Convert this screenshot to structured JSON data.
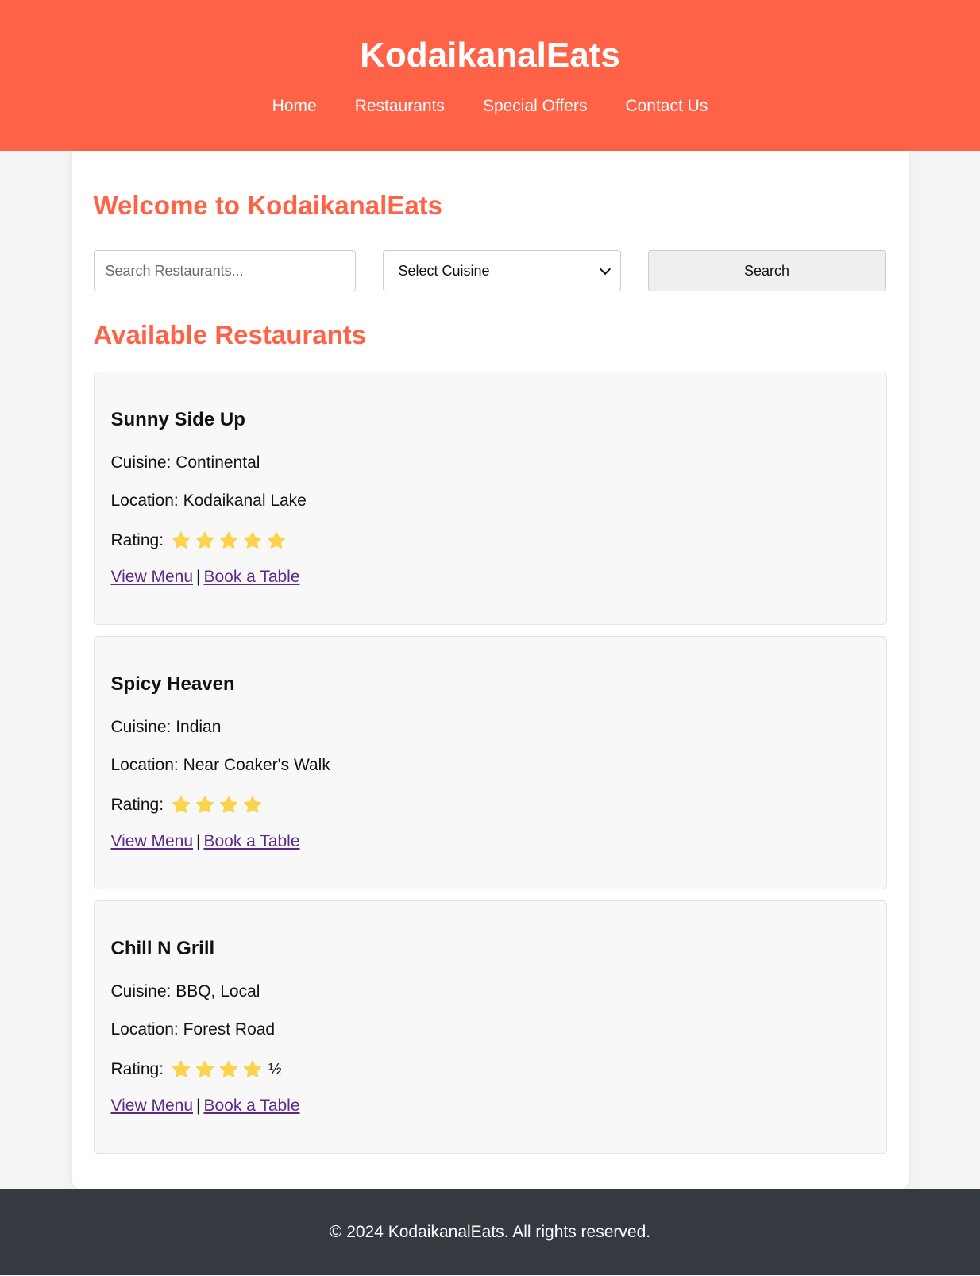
{
  "header": {
    "title": "KodaikanalEats",
    "nav": [
      "Home",
      "Restaurants",
      "Special Offers",
      "Contact Us"
    ]
  },
  "main": {
    "welcome_heading": "Welcome to KodaikanalEats",
    "search": {
      "placeholder": "Search Restaurants...",
      "value": "",
      "cuisine_selected": "Select Cuisine",
      "button_label": "Search"
    },
    "restaurants_heading": "Available Restaurants",
    "restaurants": [
      {
        "name": "Sunny Side Up",
        "cuisine": "Cuisine: Continental",
        "location": "Location: Kodaikanal Lake",
        "rating_label": "Rating:",
        "rating": 5,
        "view_menu": "View Menu",
        "separator": "|",
        "book_table": "Book a Table"
      },
      {
        "name": "Spicy Heaven",
        "cuisine": "Cuisine: Indian",
        "location": "Location: Near Coaker's Walk",
        "rating_label": "Rating:",
        "rating": 4,
        "view_menu": "View Menu",
        "separator": "|",
        "book_table": "Book a Table"
      },
      {
        "name": "Chill N Grill",
        "cuisine": "Cuisine: BBQ, Local",
        "location": "Location: Forest Road",
        "rating_label": "Rating:",
        "rating": 4.5,
        "half_glyph": "½",
        "view_menu": "View Menu",
        "separator": "|",
        "book_table": "Book a Table"
      }
    ]
  },
  "footer": {
    "text": "© 2024 KodaikanalEats. All rights reserved."
  },
  "colors": {
    "brand": "#ff6347",
    "footer_bg": "#343a40",
    "star": "#fcd34d",
    "link": "#5b2a86"
  },
  "icons": {
    "star": "star-icon",
    "select_arrow": "chevron-down-icon"
  }
}
